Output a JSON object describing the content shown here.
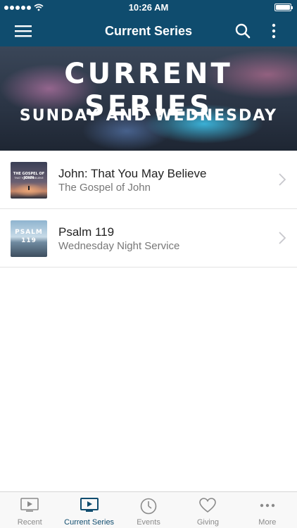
{
  "status_bar": {
    "time": "10:26 AM",
    "signal_dots": 5,
    "battery_level": 1.0
  },
  "nav": {
    "title": "Current Series",
    "icons": [
      "menu-icon",
      "search-icon",
      "more-vertical-icon"
    ]
  },
  "hero": {
    "title": "CURRENT SERIES",
    "subtitle": "SUNDAY AND WEDNESDAY"
  },
  "series": [
    {
      "title": "John: That You May Believe",
      "subtitle": "The Gospel of John",
      "thumb_line1": "THE GOSPEL OF JOHN",
      "thumb_line2": "THAT YOU MAY BELIEVE"
    },
    {
      "title": "Psalm 119",
      "subtitle": "Wednesday Night Service",
      "thumb_line1": "PSALM",
      "thumb_line2": "119"
    }
  ],
  "tabs": [
    {
      "label": "Recent",
      "icon": "play-screen-icon",
      "active": false
    },
    {
      "label": "Current Series",
      "icon": "tv-play-icon",
      "active": true
    },
    {
      "label": "Events",
      "icon": "clock-icon",
      "active": false
    },
    {
      "label": "Giving",
      "icon": "heart-icon",
      "active": false
    },
    {
      "label": "More",
      "icon": "more-horizontal-icon",
      "active": false
    }
  ],
  "colors": {
    "primary": "#0f4c6e",
    "tab_inactive": "#8a8a8a"
  }
}
